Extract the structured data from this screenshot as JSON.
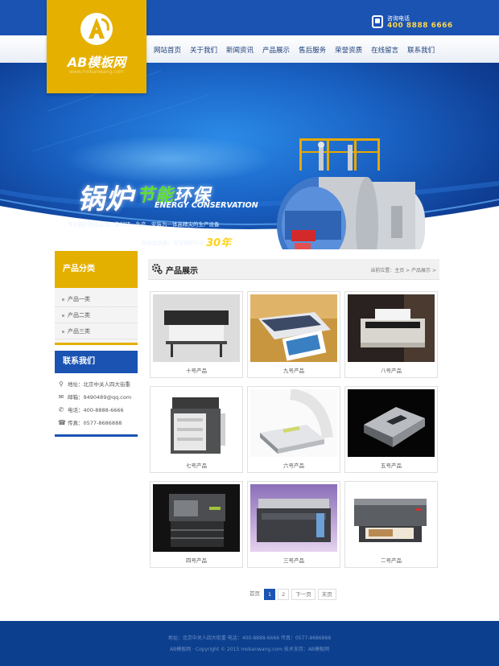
{
  "logo": {
    "brand": "AB模板网",
    "tagline": "www.mobanwang.com"
  },
  "hotline": {
    "label": "咨询电话",
    "number": "400 8888 6666",
    "icon": "phone-icon"
  },
  "nav": {
    "items": [
      "网站首页",
      "关于我们",
      "新闻资讯",
      "产品展示",
      "售后服务",
      "荣誉资质",
      "在线留言",
      "联系我们"
    ]
  },
  "banner": {
    "title_main": "锅炉",
    "title_green": "节能",
    "title_white": "环保",
    "title_en": "ENERGY CONSERVATION",
    "line1": "专业锅炉制造企业，集科研、生产、安装为一体高精尖的生产设备",
    "line2_prefix": "和检验设备，专注锅炉行业",
    "line2_years": "30年"
  },
  "sidebar": {
    "category_title": "产品分类",
    "categories": [
      "产品一类",
      "产品二类",
      "产品三类"
    ],
    "contact_title": "联系我们",
    "contacts": [
      {
        "icon": "location-icon",
        "text": "地址：北京中关人四大街重"
      },
      {
        "icon": "mail-icon",
        "text": "邮箱：9490489@qq.com"
      },
      {
        "icon": "phone-icon",
        "text": "电话：400-8888-6666"
      },
      {
        "icon": "fax-icon",
        "text": "传真：0577-8686888"
      }
    ]
  },
  "main": {
    "title": "产品展示",
    "breadcrumb": "当前位置：主页 > 产品展示 >",
    "products": [
      {
        "caption": "十号产品"
      },
      {
        "caption": "九号产品"
      },
      {
        "caption": "八号产品"
      },
      {
        "caption": "七号产品"
      },
      {
        "caption": "六号产品"
      },
      {
        "caption": "五号产品"
      },
      {
        "caption": "四号产品"
      },
      {
        "caption": "三号产品"
      },
      {
        "caption": "二号产品"
      }
    ]
  },
  "pager": {
    "first": "首页",
    "page1": "1",
    "page2": "2",
    "next": "下一页",
    "last": "末页"
  },
  "footer": {
    "line1": "地址：北京中关人四大街重    电话：400-8888-6666    传真：0577-8686888",
    "line2": "AB模板网 · Copyright © 2015 mobanwang.com    技术支持：AB模板网"
  },
  "colors": {
    "brand_blue": "#1b53b3",
    "brand_yellow": "#e4b000",
    "footer": "#0c3f8e"
  }
}
